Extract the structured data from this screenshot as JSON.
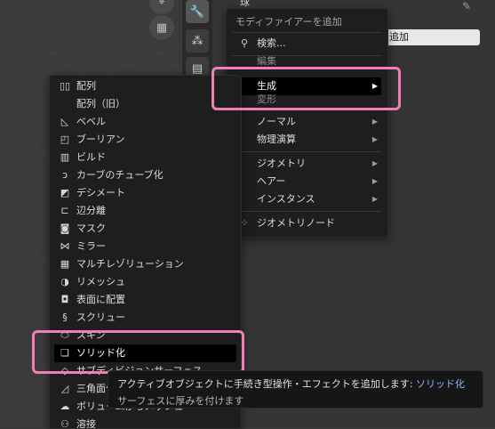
{
  "viewport": {
    "buttons": [
      {
        "name": "camera-gizmo-icon",
        "glyph": "⌖"
      },
      {
        "name": "grid-view-icon",
        "glyph": "▦"
      }
    ]
  },
  "properties": {
    "tab_icons": [
      {
        "name": "modifier-wrench-icon",
        "glyph": "🔧"
      },
      {
        "name": "particles-icon",
        "glyph": "⁂"
      },
      {
        "name": "physics-icon",
        "glyph": "▤"
      }
    ],
    "add_modifier_button": "追加",
    "title_fragment": "球",
    "hidden_fragment_1": "編集",
    "hidden_fragment_2": "変形"
  },
  "add_menu": {
    "title": "モディファイアーを追加",
    "search": "検索...",
    "items": [
      {
        "label": "生成",
        "active": true
      },
      {
        "label": "ノーマル",
        "active": false
      },
      {
        "label": "物理演算",
        "active": false
      },
      {
        "label": "ジオメトリ",
        "active": false
      },
      {
        "label": "ヘアー",
        "active": false
      },
      {
        "label": "インスタンス",
        "active": false
      }
    ],
    "geometry_nodes": "ジオメトリノード",
    "submenu_arrow": "▶"
  },
  "generate_menu": {
    "items": [
      {
        "label": "配列",
        "icon": "▯▯",
        "name": "array-icon"
      },
      {
        "label": "配列（旧）",
        "icon": "",
        "name": "array-legacy-icon"
      },
      {
        "label": "ベベル",
        "icon": "◺",
        "name": "bevel-icon"
      },
      {
        "label": "ブーリアン",
        "icon": "◰",
        "name": "boolean-icon"
      },
      {
        "label": "ビルド",
        "icon": "▥",
        "name": "build-icon"
      },
      {
        "label": "カーブのチューブ化",
        "icon": "ↄ",
        "name": "curve-to-tube-icon"
      },
      {
        "label": "デシメート",
        "icon": "◩",
        "name": "decimate-icon"
      },
      {
        "label": "辺分離",
        "icon": "⊏",
        "name": "edge-split-icon"
      },
      {
        "label": "マスク",
        "icon": "◙",
        "name": "mask-icon"
      },
      {
        "label": "ミラー",
        "icon": "⋈",
        "name": "mirror-icon"
      },
      {
        "label": "マルチレゾリューション",
        "icon": "▦",
        "name": "multires-icon"
      },
      {
        "label": "リメッシュ",
        "icon": "◑",
        "name": "remesh-icon"
      },
      {
        "label": "表面に配置",
        "icon": "◘",
        "name": "surface-deform-icon"
      },
      {
        "label": "スクリュー",
        "icon": "§",
        "name": "screw-icon"
      },
      {
        "label": "スキン",
        "icon": "⬭",
        "name": "skin-icon"
      },
      {
        "label": "ソリッド化",
        "icon": "❏",
        "name": "solidify-icon",
        "active": true
      },
      {
        "label": "サブディビジョンサーフェス",
        "icon": "◇",
        "name": "subsurf-icon"
      },
      {
        "label": "三角面化",
        "icon": "◿",
        "name": "triangulate-icon"
      },
      {
        "label": "ボリュームからメッシュ",
        "icon": "☁",
        "name": "volume-to-mesh-icon"
      },
      {
        "label": "溶接",
        "icon": "⚇",
        "name": "weld-icon"
      }
    ]
  },
  "tooltip": {
    "main": "アクティブオブジェクトに手続き型操作・エフェクトを追加します: ",
    "highlight": "ソリッド化",
    "description": "サーフェスに厚みを付けます"
  },
  "colors": {
    "highlight_border": "#f07fb6",
    "menu_bg": "#1e1e1e",
    "tooltip_accent": "#8fb6ff"
  }
}
